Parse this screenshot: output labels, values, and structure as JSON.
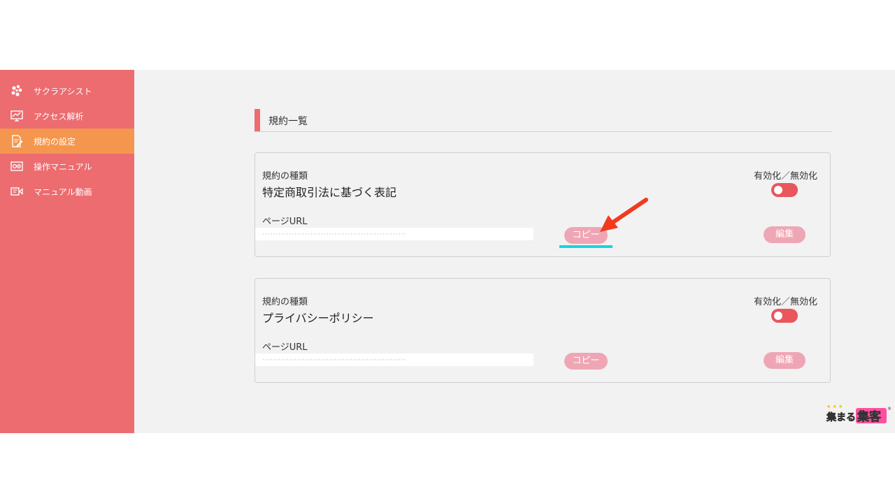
{
  "sidebar": {
    "items": [
      {
        "label": "サクラアシスト",
        "icon": "sakura-icon",
        "active": false
      },
      {
        "label": "アクセス解析",
        "icon": "chart-monitor-icon",
        "active": false
      },
      {
        "label": "規約の設定",
        "icon": "document-edit-icon",
        "active": true
      },
      {
        "label": "操作マニュアル",
        "icon": "manual-icon",
        "active": false
      },
      {
        "label": "マニュアル動画",
        "icon": "video-icon",
        "active": false
      }
    ]
  },
  "main": {
    "section_title": "規約一覧",
    "cards": [
      {
        "type_label": "規約の種類",
        "type_value": "特定商取引法に基づく表記",
        "toggle_label": "有効化／無効化",
        "toggle_on": true,
        "url_label": "ページURL",
        "copy_label": "コピー",
        "edit_label": "編集"
      },
      {
        "type_label": "規約の種類",
        "type_value": "プライバシーポリシー",
        "toggle_label": "有効化／無効化",
        "toggle_on": true,
        "url_label": "ページURL",
        "copy_label": "コピー",
        "edit_label": "編集"
      }
    ]
  },
  "brand": {
    "logo_text": "集まる集客"
  },
  "colors": {
    "sidebar": "#ec6c70",
    "sidebar_active": "#f5964e",
    "accent": "#ec6c70",
    "button": "#efa6b4",
    "toggle": "#e9565c",
    "highlight": "#1ad3e3",
    "arrow": "#f23a1f"
  }
}
